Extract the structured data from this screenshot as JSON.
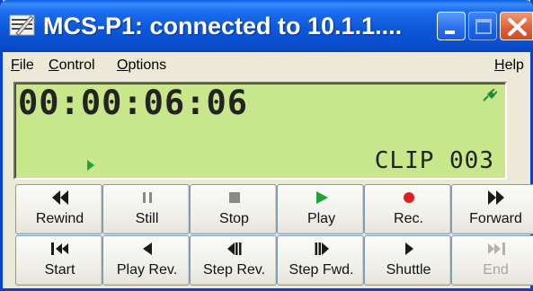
{
  "window": {
    "title": "MCS-P1: connected to 10.1.1....",
    "buttons": {
      "minimize": "minimize",
      "maximize": "maximize",
      "close": "close"
    }
  },
  "menu": {
    "file": {
      "mnemonic": "F",
      "rest": "ile"
    },
    "control": {
      "mnemonic": "C",
      "rest": "ontrol"
    },
    "options": {
      "mnemonic": "O",
      "rest": "ptions"
    },
    "help": {
      "mnemonic": "H",
      "rest": "elp"
    }
  },
  "display": {
    "timecode": "00:00:06:06",
    "clip": "CLIP 003",
    "status_icon": "play-indicator-icon",
    "connection_icon": "connection-plug-icon"
  },
  "transport": {
    "row1": [
      {
        "label": "Rewind",
        "icon": "rewind-icon"
      },
      {
        "label": "Still",
        "icon": "pause-icon"
      },
      {
        "label": "Stop",
        "icon": "stop-icon"
      },
      {
        "label": "Play",
        "icon": "play-icon"
      },
      {
        "label": "Rec.",
        "icon": "record-icon"
      },
      {
        "label": "Forward",
        "icon": "fast-forward-icon"
      }
    ],
    "row2": [
      {
        "label": "Start",
        "icon": "go-to-start-icon"
      },
      {
        "label": "Play Rev.",
        "icon": "play-reverse-icon"
      },
      {
        "label": "Step Rev.",
        "icon": "step-reverse-icon"
      },
      {
        "label": "Step Fwd.",
        "icon": "step-forward-icon"
      },
      {
        "label": "Shuttle",
        "icon": "shuttle-icon"
      },
      {
        "label": "End",
        "icon": "go-to-end-icon",
        "enabled": false
      }
    ]
  },
  "colors": {
    "lcd_background": "#c8e68a",
    "play_green": "#1fa33a",
    "record_red": "#e02020",
    "title_bar_blue": "#0c58d8"
  }
}
